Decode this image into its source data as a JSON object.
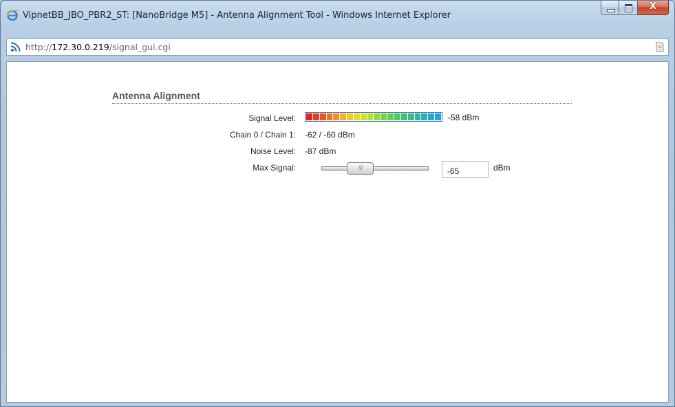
{
  "window": {
    "title": "VipnetBB_JBO_PBR2_ST: [NanoBridge M5] - Antenna Alignment Tool - Windows Internet Explorer",
    "close_glyph": "X"
  },
  "address": {
    "prefix": "http://",
    "host": "172.30.0.219",
    "path": "/signal_gui.cgi"
  },
  "page": {
    "section_title": "Antenna Alignment",
    "signal_level": {
      "label": "Signal Level:",
      "value": "-58 dBm",
      "segment_count": 20,
      "segment_colors": [
        "#e8231a",
        "#ec3a1c",
        "#f0521f",
        "#f46f21",
        "#f78f24",
        "#f9ad27",
        "#f8c82a",
        "#e9d92d",
        "#d3e02f",
        "#b8de33",
        "#9ad83a",
        "#7fd143",
        "#67cb4f",
        "#54c55f",
        "#46bf73",
        "#3cb98a",
        "#33b3a2",
        "#2baeba",
        "#24a9cd",
        "#1ea4dc"
      ]
    },
    "chain": {
      "label": "Chain 0 / Chain 1:",
      "value": "-62 / -60 dBm"
    },
    "noise": {
      "label": "Noise Level:",
      "value": "-87 dBm"
    },
    "max_signal": {
      "label": "Max Signal:",
      "value": "-65",
      "unit": "dBm",
      "grip": "///"
    }
  }
}
